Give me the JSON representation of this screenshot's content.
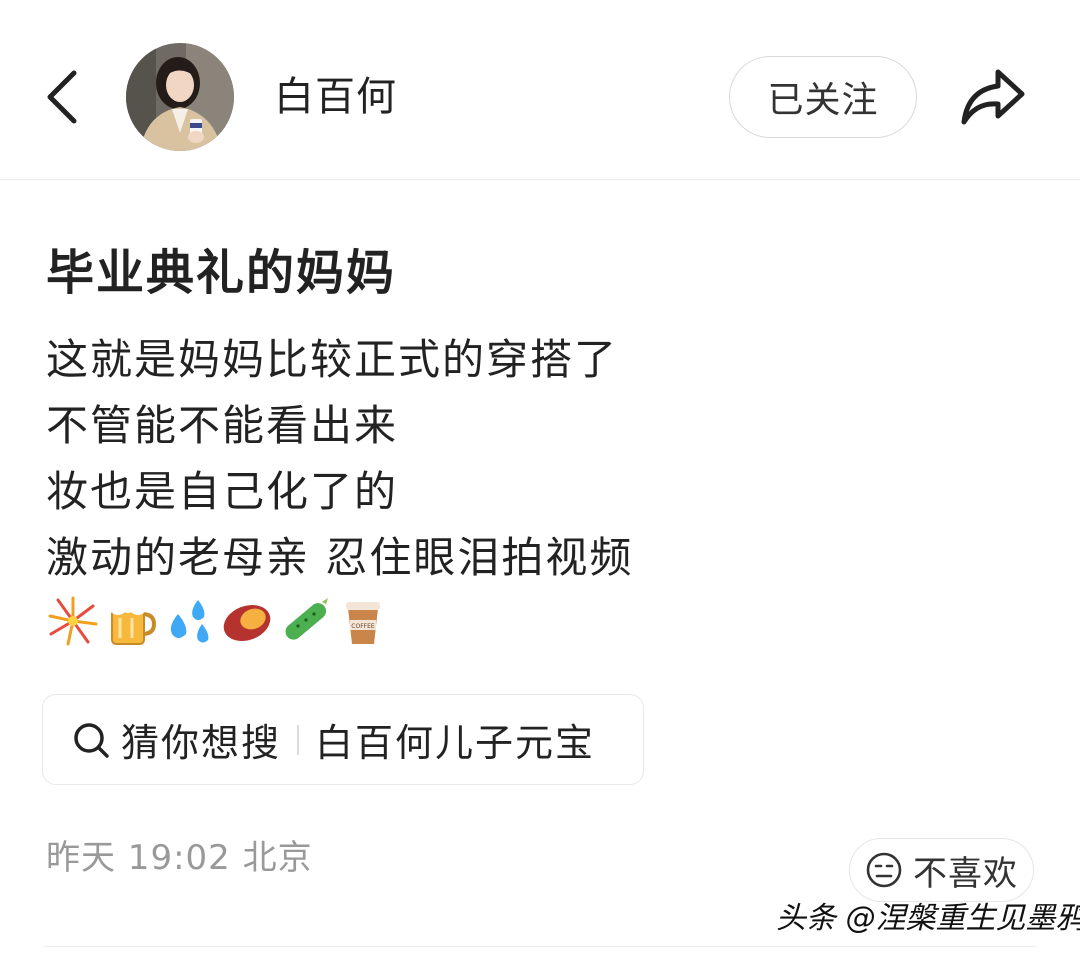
{
  "header": {
    "username": "白百何",
    "follow_label": "已关注"
  },
  "post": {
    "title": "毕业典礼的妈妈",
    "lines": [
      "这就是妈妈比较正式的穿搭了",
      "不管能不能看出来",
      "妆也是自己化了的",
      "激动的老母亲 忍住眼泪拍视频"
    ],
    "emojis": [
      "fireworks-emoji",
      "beer-emoji",
      "sweat-drops-emoji",
      "sweet-potato-emoji",
      "cucumber-emoji",
      "coffee-emoji"
    ],
    "coffee_cup_text": "COFFEE"
  },
  "suggestion": {
    "label": "猜你想搜",
    "query": "白百何儿子元宝"
  },
  "meta": {
    "time": "昨天 19:02",
    "location": "北京"
  },
  "actions": {
    "dislike_label": "不喜欢"
  },
  "watermark": "头条 @涅槃重生见墨鸦",
  "colors": {
    "text": "#222222",
    "muted": "#999999",
    "border": "#e6e6e6"
  },
  "icons": {
    "back": "chevron-left-icon",
    "share": "share-arrow-icon",
    "search": "search-icon",
    "dislike": "neutral-face-icon"
  }
}
